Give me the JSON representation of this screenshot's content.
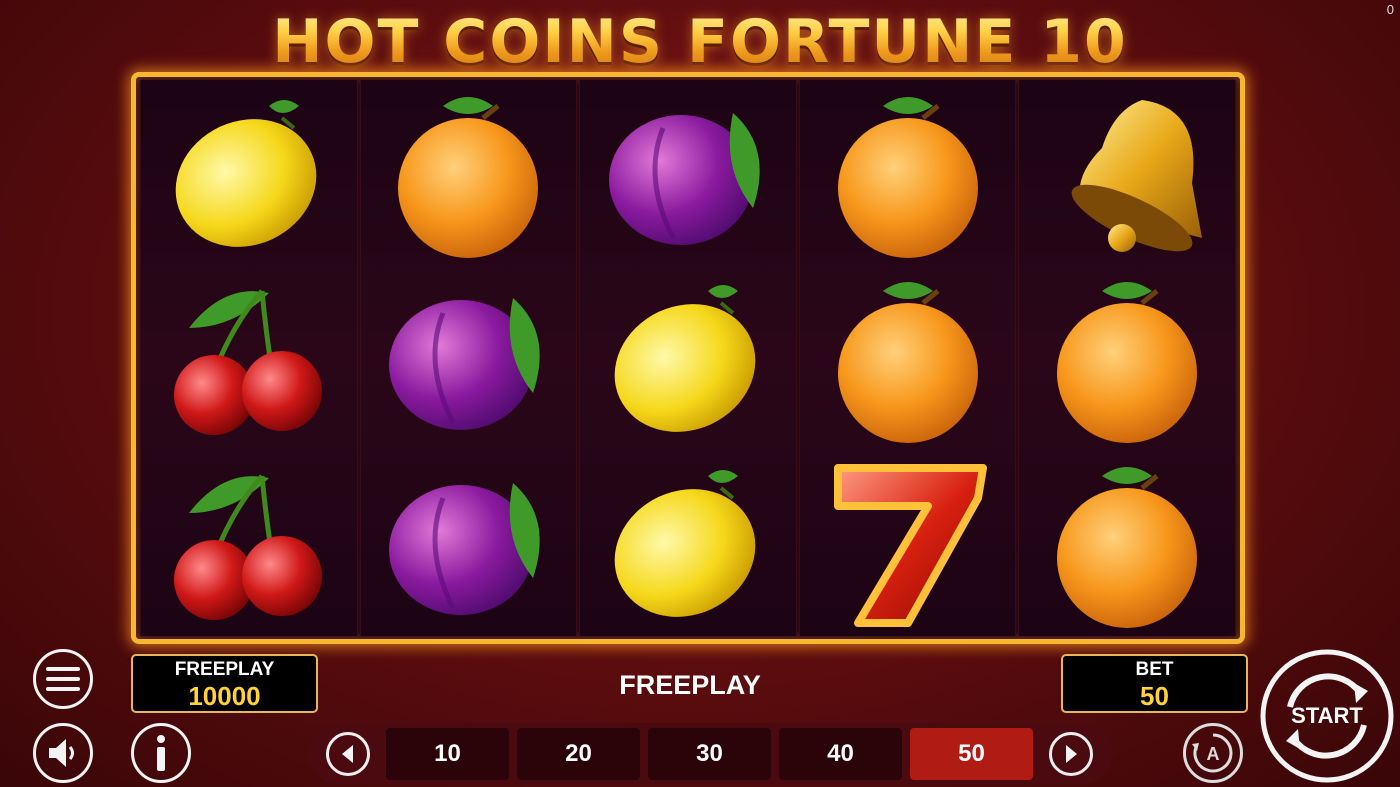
{
  "corner_counter": "0",
  "title": "HOT COINS FORTUNE 10",
  "reels": [
    [
      "lemon",
      "cherry",
      "cherry"
    ],
    [
      "orange",
      "plum",
      "plum"
    ],
    [
      "plum",
      "lemon",
      "lemon"
    ],
    [
      "orange",
      "orange",
      "seven"
    ],
    [
      "bell",
      "orange",
      "orange"
    ]
  ],
  "balance": {
    "label": "FREEPLAY",
    "value": "10000"
  },
  "message": "FREEPLAY",
  "bet": {
    "label": "BET",
    "value": "50"
  },
  "bet_options": [
    "10",
    "20",
    "30",
    "40",
    "50"
  ],
  "selected_bet_index": 4,
  "start_label": "START",
  "icons": {
    "menu": "hamburger-menu-icon",
    "sound": "speaker-icon",
    "info": "info-icon",
    "autoplay": "autoplay-icon",
    "prev": "chevron-left-icon",
    "next": "chevron-right-icon"
  },
  "colors": {
    "frame_gold": "#f7b733",
    "value_yellow": "#ffd23a",
    "active_bet": "#b01c14"
  }
}
